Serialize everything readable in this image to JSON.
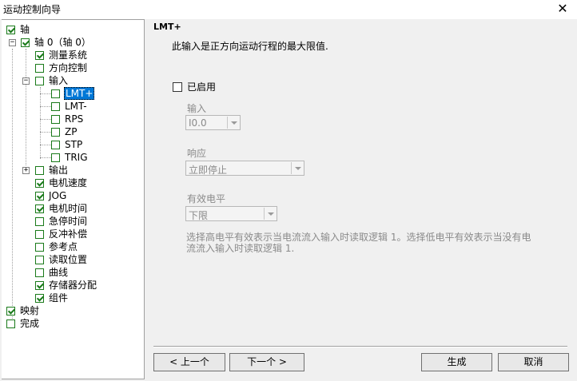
{
  "window": {
    "title": "运动控制向导",
    "close_glyph": "✕"
  },
  "tree": {
    "items": [
      {
        "label": "轴",
        "checked": true
      },
      {
        "label": "轴 0（轴 0）",
        "checked": true,
        "expander": "−"
      },
      {
        "label": "测量系统",
        "checked": true
      },
      {
        "label": "方向控制",
        "checked": false
      },
      {
        "label": "输入",
        "checked": false,
        "expander": "−"
      },
      {
        "label": "LMT+",
        "checked": false,
        "selected": true
      },
      {
        "label": "LMT-",
        "checked": false
      },
      {
        "label": "RPS",
        "checked": false
      },
      {
        "label": "ZP",
        "checked": false
      },
      {
        "label": "STP",
        "checked": false
      },
      {
        "label": "TRIG",
        "checked": false
      },
      {
        "label": "输出",
        "checked": false,
        "expander": "+"
      },
      {
        "label": "电机速度",
        "checked": true
      },
      {
        "label": "JOG",
        "checked": true
      },
      {
        "label": "电机时间",
        "checked": true
      },
      {
        "label": "急停时间",
        "checked": false
      },
      {
        "label": "反冲补偿",
        "checked": false
      },
      {
        "label": "参考点",
        "checked": false
      },
      {
        "label": "读取位置",
        "checked": false
      },
      {
        "label": "曲线",
        "checked": false
      },
      {
        "label": "存储器分配",
        "checked": true
      },
      {
        "label": "组件",
        "checked": true
      },
      {
        "label": "映射",
        "checked": true
      },
      {
        "label": "完成",
        "checked": false
      }
    ]
  },
  "content": {
    "heading": "LMT+",
    "description": "此输入是正方向运动行程的最大限值.",
    "enable_label": "已启用",
    "input": {
      "label": "输入",
      "value": "I0.0"
    },
    "response": {
      "label": "响应",
      "value": "立即停止"
    },
    "level": {
      "label": "有效电平",
      "value": "下限"
    },
    "hint": "选择高电平有效表示当电流流入输入时读取逻辑 1。选择低电平有效表示当没有电流流入输入时读取逻辑 1."
  },
  "buttons": {
    "prev": "< 上一个",
    "next": "下一个 >",
    "generate": "生成",
    "cancel": "取消"
  }
}
